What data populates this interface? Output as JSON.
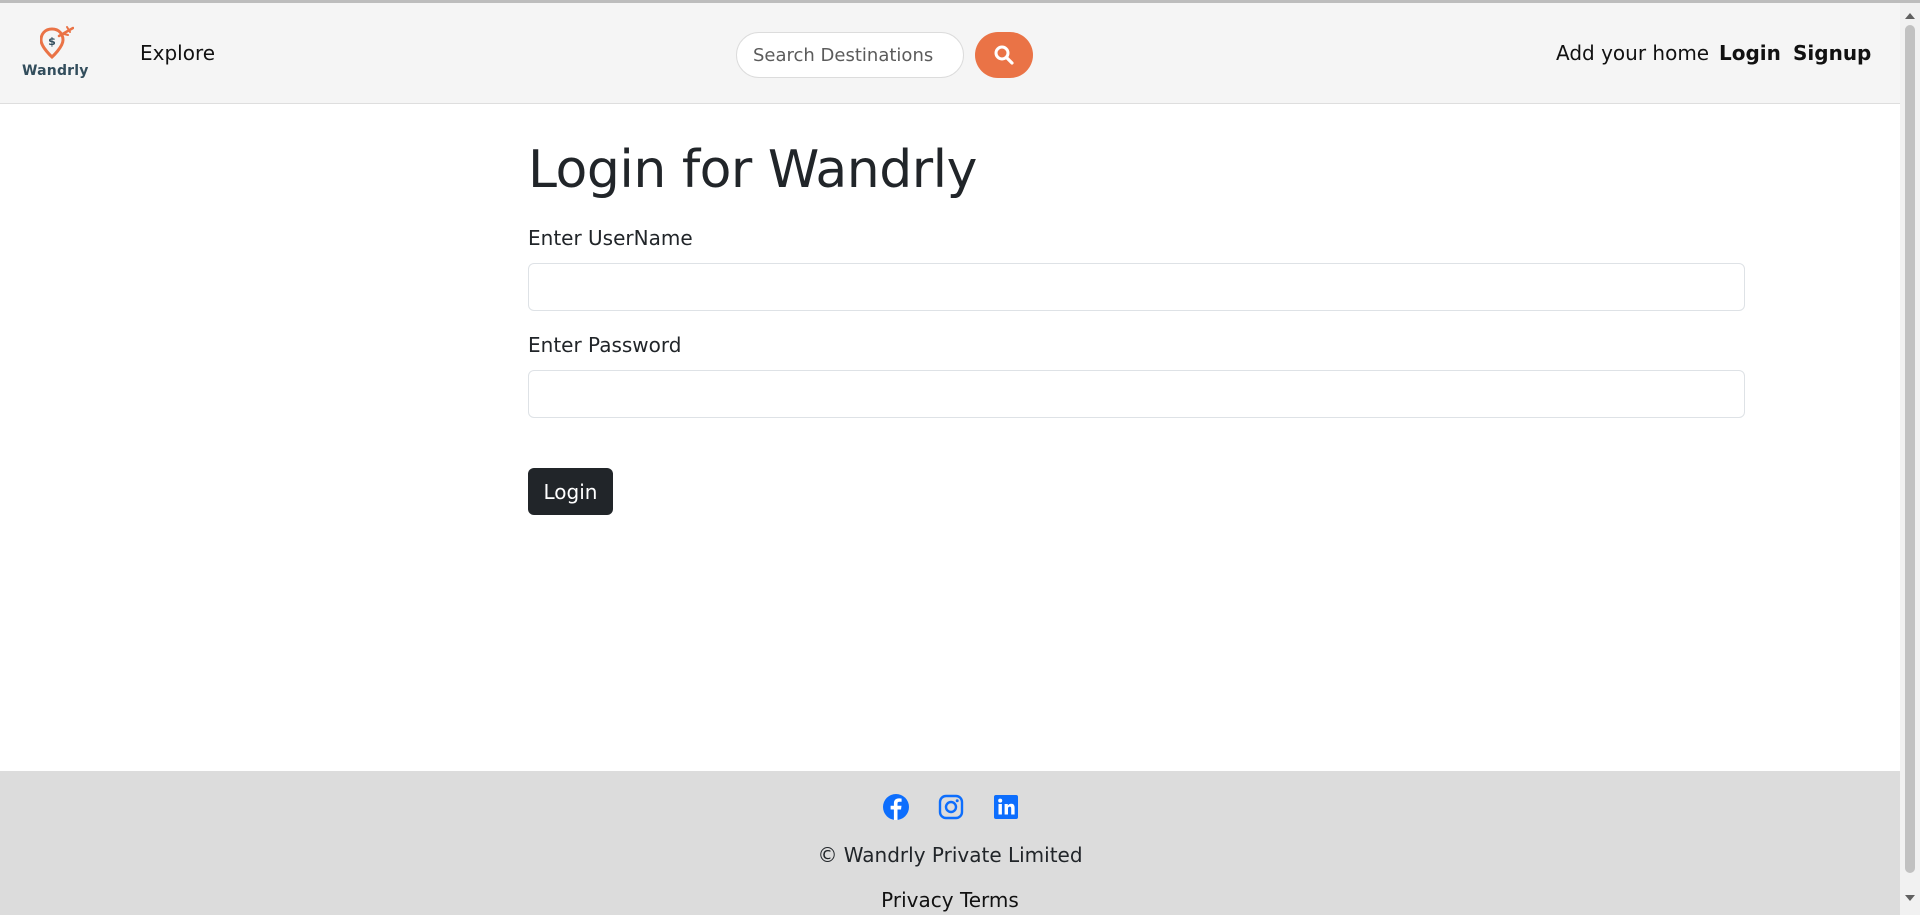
{
  "brand": {
    "name": "Wandrly",
    "logo_icon": "location-plane-icon",
    "accent_color": "#ea7346",
    "logo_text_color": "#324d5c"
  },
  "nav": {
    "explore": "Explore",
    "search_placeholder": "Search Destinations",
    "search_icon": "search-icon",
    "add_home": "Add your home",
    "login": "Login",
    "signup": "Signup"
  },
  "main": {
    "title": "Login for Wandrly",
    "username_label": "Enter UserName",
    "username_value": "",
    "password_label": "Enter Password",
    "password_value": "",
    "submit": "Login",
    "submit_color": "#212529"
  },
  "footer": {
    "social": [
      {
        "name": "facebook-icon"
      },
      {
        "name": "instagram-icon"
      },
      {
        "name": "linkedin-icon"
      }
    ],
    "social_color": "#0d6efd",
    "copyright": "© Wandrly Private Limited",
    "privacy": "Privacy",
    "terms": "Terms"
  }
}
